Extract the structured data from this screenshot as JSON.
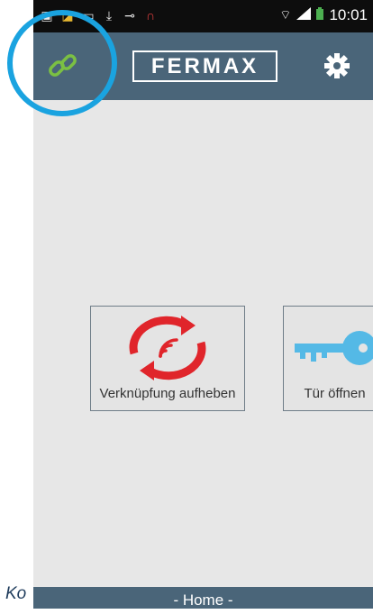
{
  "statusbar": {
    "time": "10:01",
    "icons": [
      "photo-icon",
      "flipboard-icon",
      "image-icon",
      "download-icon",
      "key-icon",
      "headphones-icon"
    ]
  },
  "header": {
    "logo_text": "FERMAX",
    "link_icon": "link-icon",
    "settings_icon": "gear-icon"
  },
  "actions": {
    "unlink_label": "Verknüpfung aufheben",
    "door_label": "Tür öffnen"
  },
  "footer": {
    "home_label": "- Home -"
  },
  "caption": {
    "text": "Ko"
  },
  "colors": {
    "appbar": "#4a6579",
    "link_green": "#7bc043",
    "unlink_red": "#e0252b",
    "key_blue": "#54b9e6",
    "highlight": "#1aa3e0"
  }
}
